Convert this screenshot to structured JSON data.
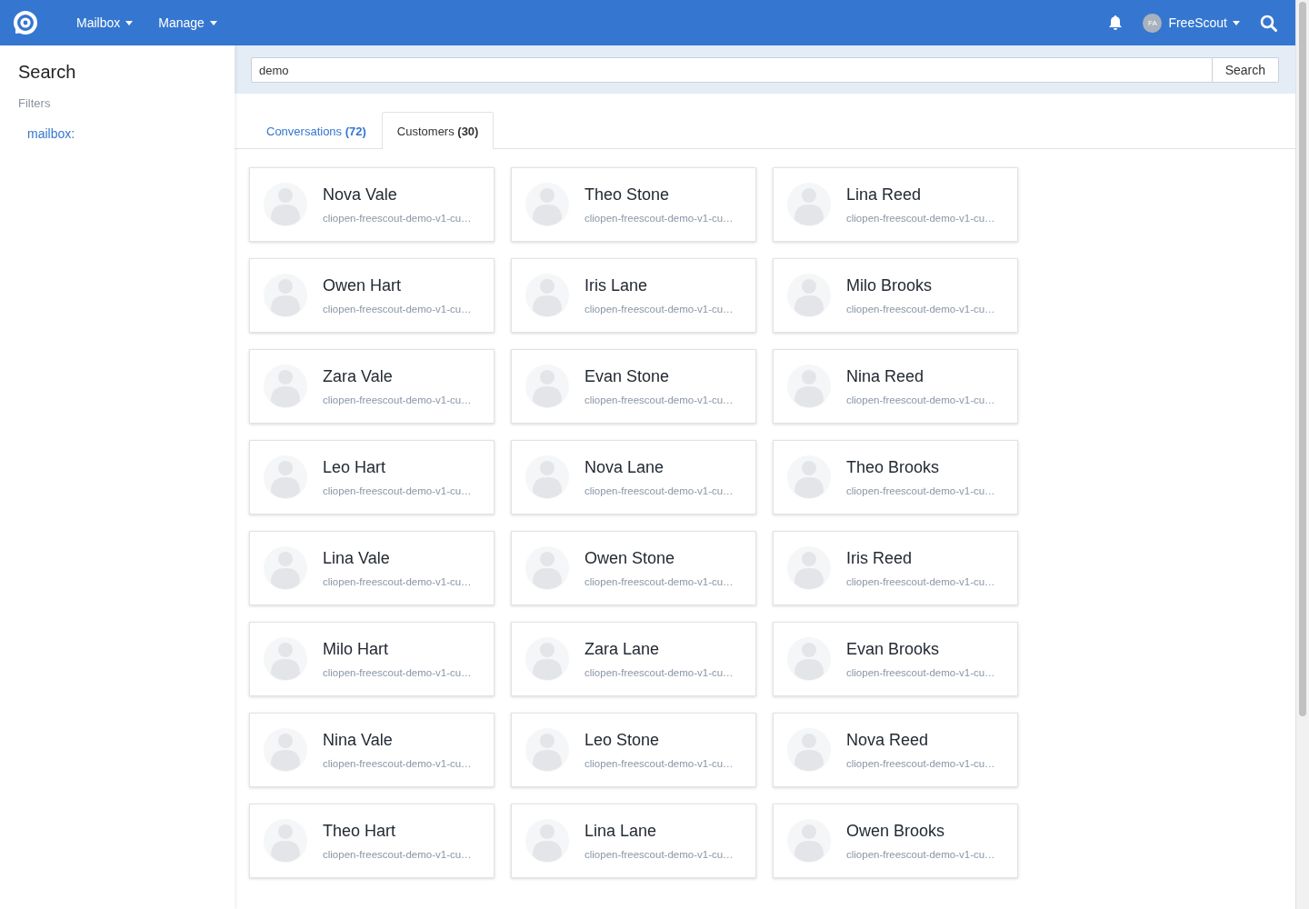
{
  "navbar": {
    "menus": [
      {
        "label": "Mailbox"
      },
      {
        "label": "Manage"
      }
    ],
    "user": {
      "initials": "FA",
      "name": "FreeScout"
    }
  },
  "sidebar": {
    "title": "Search",
    "filters_label": "Filters",
    "filters": [
      {
        "label": "mailbox:"
      }
    ]
  },
  "search": {
    "value": "demo",
    "button": "Search"
  },
  "tabs": [
    {
      "label": "Conversations",
      "count": "(72)",
      "selected": false
    },
    {
      "label": "Customers",
      "count": "(30)",
      "selected": true
    }
  ],
  "customers": [
    {
      "name": "Nova Vale",
      "email": "cliopen-freescout-demo-v1-cu…"
    },
    {
      "name": "Theo Stone",
      "email": "cliopen-freescout-demo-v1-cu…"
    },
    {
      "name": "Lina Reed",
      "email": "cliopen-freescout-demo-v1-cu…"
    },
    {
      "name": "Owen Hart",
      "email": "cliopen-freescout-demo-v1-cu…"
    },
    {
      "name": "Iris Lane",
      "email": "cliopen-freescout-demo-v1-cu…"
    },
    {
      "name": "Milo Brooks",
      "email": "cliopen-freescout-demo-v1-cu…"
    },
    {
      "name": "Zara Vale",
      "email": "cliopen-freescout-demo-v1-cu…"
    },
    {
      "name": "Evan Stone",
      "email": "cliopen-freescout-demo-v1-cu…"
    },
    {
      "name": "Nina Reed",
      "email": "cliopen-freescout-demo-v1-cu…"
    },
    {
      "name": "Leo Hart",
      "email": "cliopen-freescout-demo-v1-cu…"
    },
    {
      "name": "Nova Lane",
      "email": "cliopen-freescout-demo-v1-cu…"
    },
    {
      "name": "Theo Brooks",
      "email": "cliopen-freescout-demo-v1-cu…"
    },
    {
      "name": "Lina Vale",
      "email": "cliopen-freescout-demo-v1-cu…"
    },
    {
      "name": "Owen Stone",
      "email": "cliopen-freescout-demo-v1-cu…"
    },
    {
      "name": "Iris Reed",
      "email": "cliopen-freescout-demo-v1-cu…"
    },
    {
      "name": "Milo Hart",
      "email": "cliopen-freescout-demo-v1-cu…"
    },
    {
      "name": "Zara Lane",
      "email": "cliopen-freescout-demo-v1-cu…"
    },
    {
      "name": "Evan Brooks",
      "email": "cliopen-freescout-demo-v1-cu…"
    },
    {
      "name": "Nina Vale",
      "email": "cliopen-freescout-demo-v1-cu…"
    },
    {
      "name": "Leo Stone",
      "email": "cliopen-freescout-demo-v1-cu…"
    },
    {
      "name": "Nova Reed",
      "email": "cliopen-freescout-demo-v1-cu…"
    },
    {
      "name": "Theo Hart",
      "email": "cliopen-freescout-demo-v1-cu…"
    },
    {
      "name": "Lina Lane",
      "email": "cliopen-freescout-demo-v1-cu…"
    },
    {
      "name": "Owen Brooks",
      "email": "cliopen-freescout-demo-v1-cu…"
    }
  ]
}
